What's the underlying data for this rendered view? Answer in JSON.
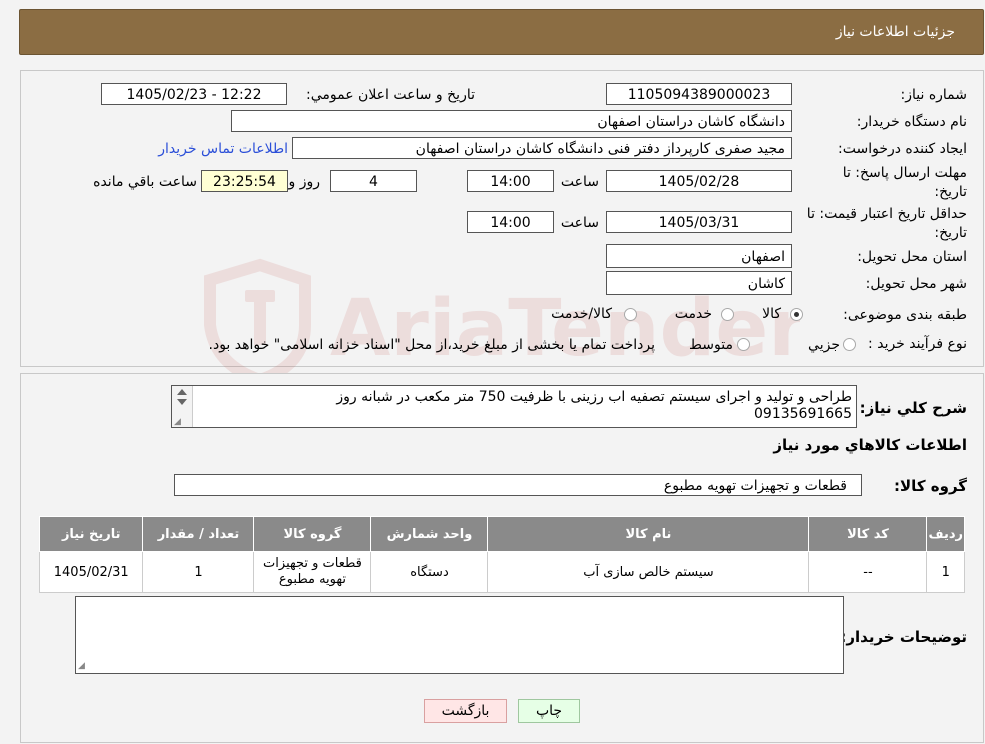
{
  "header": {
    "title": "جزئيات اطلاعات نياز"
  },
  "form": {
    "need_number_label": "شماره نیاز:",
    "need_number": "1105094389000023",
    "announce_label": "تاريخ و ساعت اعلان عمومي:",
    "announce_value": "1405/02/23 - 12:22",
    "buyer_org_label": "نام دستگاه خريدار:",
    "buyer_org": "دانشگاه کاشان دراستان اصفهان",
    "requester_label": "ایجاد کننده درخواست:",
    "requester": "مجید صفری کارپرداز دفتر فنی دانشگاه کاشان دراستان اصفهان",
    "contact_link": "اطلاعات تماس خريدار",
    "deadline_label_1": "مهلت ارسال پاسخ: تا",
    "deadline_label_2": "تاریخ:",
    "deadline_date": "1405/02/28",
    "time_label": "ساعت",
    "deadline_time": "14:00",
    "days_value": "4",
    "days_label": "روز و",
    "remaining_time": "23:25:54",
    "remaining_label": "ساعت باقي مانده",
    "validity_label_1": "حداقل تاريخ اعتبار قيمت: تا",
    "validity_label_2": "تاريخ:",
    "validity_date": "1405/03/31",
    "validity_time": "14:00",
    "province_label": "استان محل تحویل:",
    "province": "اصفهان",
    "city_label": "شهر محل تحویل:",
    "city": "کاشان",
    "category_label": "طبقه بندی موضوعی:",
    "category_options": [
      "کالا",
      "خدمت",
      "کالا/خدمت"
    ],
    "category_selected": "کالا",
    "process_label": "نوع فرآيند خريد :",
    "process_options": [
      "جزيي",
      "متوسط"
    ],
    "process_note": "پرداخت تمام یا بخشی از مبلغ خرید،از محل \"اسناد خزانه اسلامی\" خواهد بود."
  },
  "description": {
    "label": "شرح كلي نياز:",
    "text": "طراحی و تولید و اجرای سیستم تصفیه اب رزینی با ظرفیت 750 متر مکعب در شبانه روز\n09135691665"
  },
  "goods": {
    "section_title": "اطلاعات كالاهاي مورد نياز",
    "group_label": "گروه كالا:",
    "group_value": "قطعات و تجهیزات تهویه مطبوع",
    "columns": [
      "رديف",
      "كد كالا",
      "نام كالا",
      "واحد شمارش",
      "گروه كالا",
      "تعداد / مقدار",
      "تاريخ نياز"
    ],
    "rows": [
      [
        "1",
        "--",
        "سیستم خالص سازی آب",
        "دستگاه",
        "قطعات و تجهیزات تهویه مطبوع",
        "1",
        "1405/02/31"
      ]
    ]
  },
  "buyer_notes": {
    "label": "توضيحات خريدار:",
    "value": ""
  },
  "buttons": {
    "print": "چاپ",
    "back": "بازگشت"
  },
  "watermark": "AriaTender.neT"
}
